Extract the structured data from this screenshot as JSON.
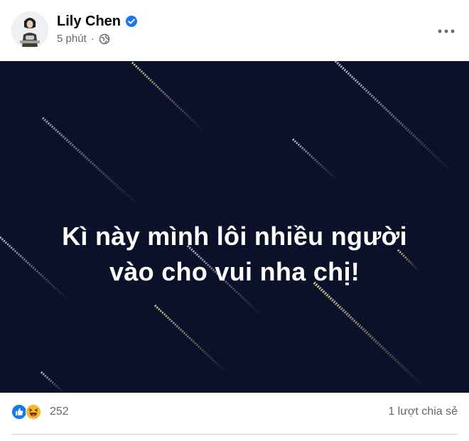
{
  "author": {
    "name": "Lily Chen",
    "verified": true,
    "time": "5 phút",
    "separator": "·",
    "privacy_icon": "globe-icon"
  },
  "header": {
    "more_icon": "more-horizontal-icon"
  },
  "media": {
    "text_line1": "Kì này mình lôi nhiều người",
    "text_line2": "vào cho vui nha chị!",
    "background_color": "#0a1128"
  },
  "footer": {
    "reaction_icons": [
      "like-icon",
      "haha-icon"
    ],
    "reaction_count": "252",
    "shares": "1 lượt chia sẻ"
  },
  "colors": {
    "secondary_text": "#65676b",
    "verified": "#1877f2",
    "like": "#1877f2",
    "haha": "#f7b928"
  }
}
